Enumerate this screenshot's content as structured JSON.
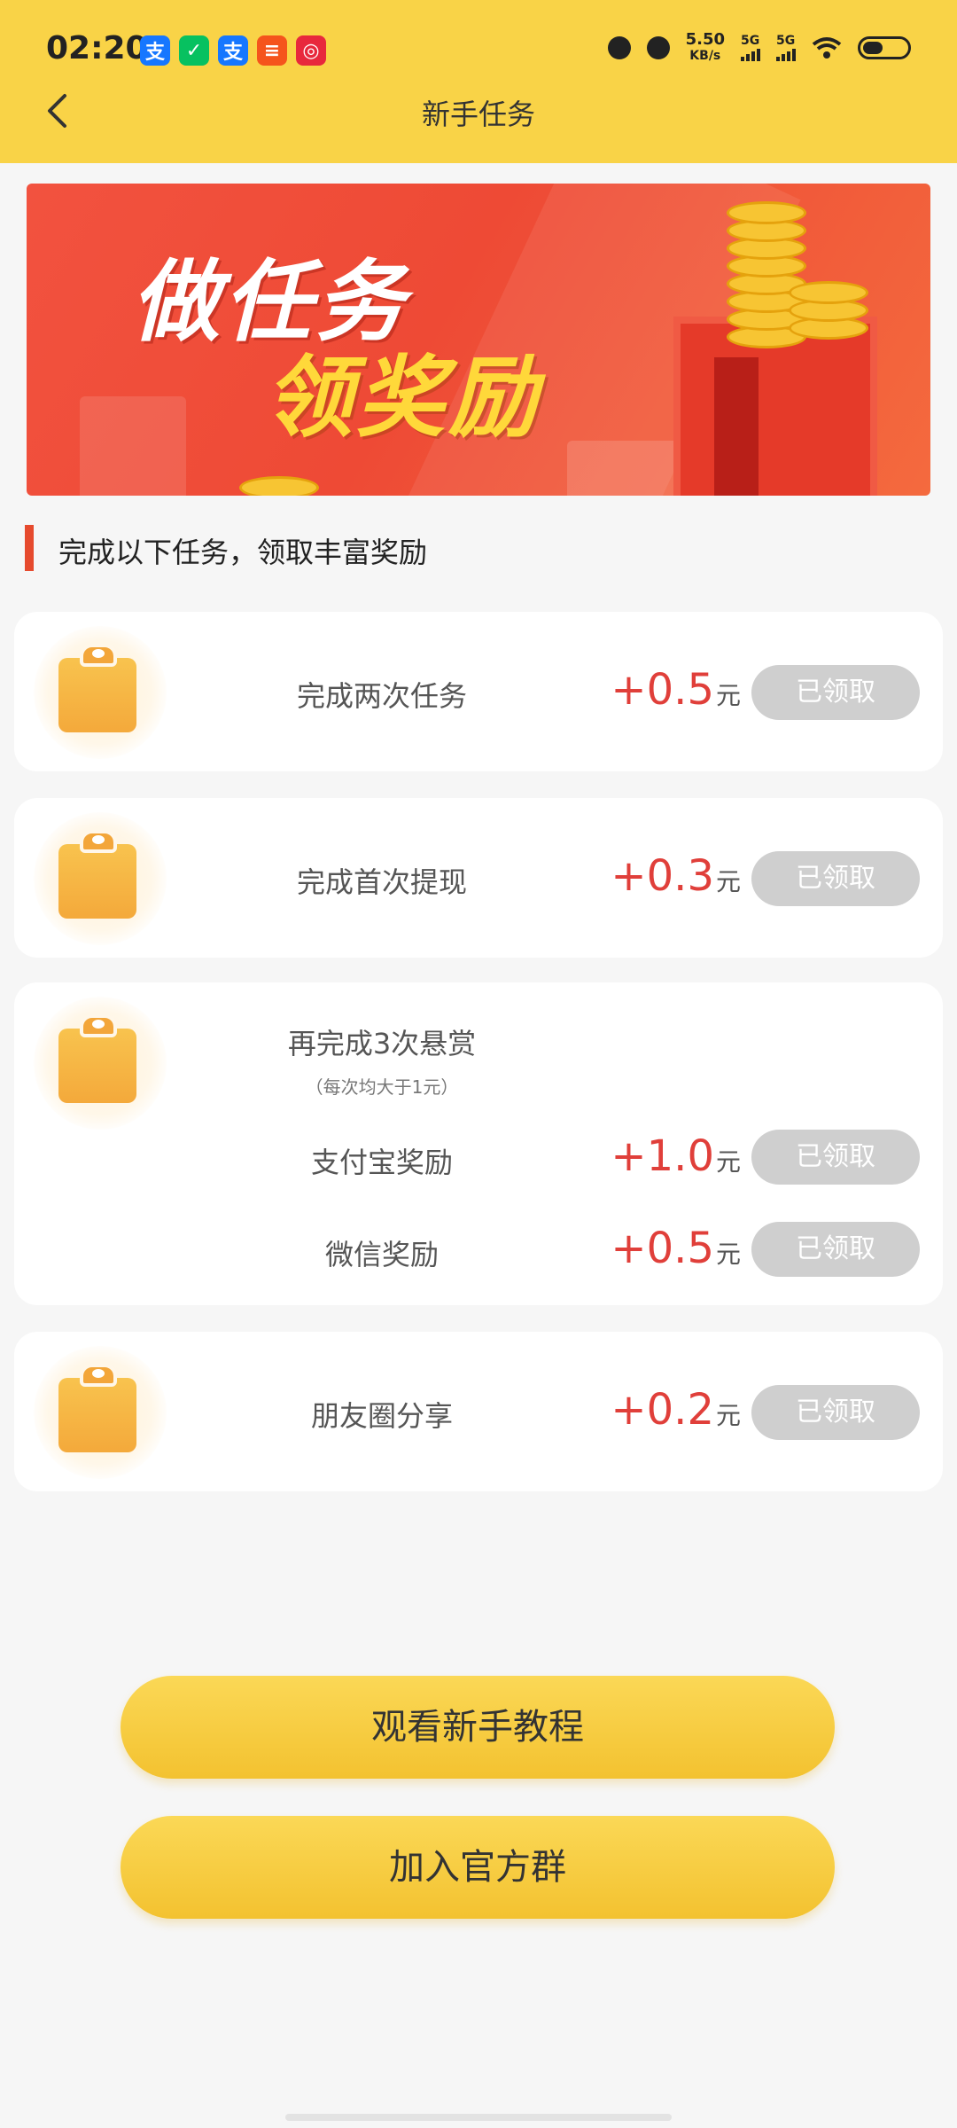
{
  "status_bar": {
    "time": "02:20",
    "apps": [
      {
        "icon": "alipay-icon",
        "glyph": "支",
        "color": "#1677ff"
      },
      {
        "icon": "wechat-icon",
        "glyph": "✓",
        "color": "#07c160"
      },
      {
        "icon": "alipay-icon",
        "glyph": "支",
        "color": "#1677ff"
      },
      {
        "icon": "app-icon",
        "glyph": "≡",
        "color": "#f5541c"
      },
      {
        "icon": "target-icon",
        "glyph": "◎",
        "color": "#e8283c"
      }
    ],
    "net_speed": "5.50",
    "net_speed_unit": "KB/s",
    "signal1": "5G",
    "signal2": "5G"
  },
  "nav": {
    "title": "新手任务"
  },
  "banner": {
    "line1": "做任务",
    "line2": "领奖励"
  },
  "section": {
    "title": "完成以下任务，领取丰富奖励"
  },
  "tasks": [
    {
      "label": "完成两次任务",
      "amount": "+0.5",
      "unit": "元",
      "button": "已领取"
    },
    {
      "label": "完成首次提现",
      "amount": "+0.3",
      "unit": "元",
      "button": "已领取"
    },
    {
      "label": "再完成3次悬赏",
      "note": "（每次均大于1元）",
      "subs": [
        {
          "label": "支付宝奖励",
          "amount": "+1.0",
          "unit": "元",
          "button": "已领取"
        },
        {
          "label": "微信奖励",
          "amount": "+0.5",
          "unit": "元",
          "button": "已领取"
        }
      ]
    },
    {
      "label": "朋友圈分享",
      "amount": "+0.2",
      "unit": "元",
      "button": "已领取"
    }
  ],
  "buttons": {
    "tutorial": "观看新手教程",
    "join_group": "加入官方群"
  },
  "colors": {
    "header": "#f9d347",
    "reward": "#e03f3a",
    "claimed_button": "#cfcfcf",
    "accent_bar": "#e64a2e"
  }
}
